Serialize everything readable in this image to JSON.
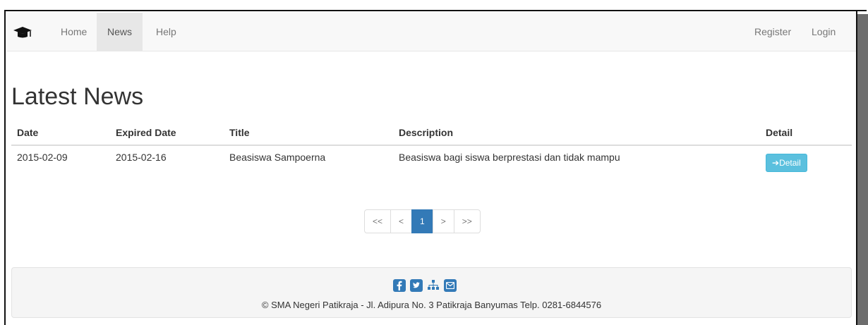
{
  "nav": {
    "left": [
      "Home",
      "News",
      "Help"
    ],
    "right": [
      "Register",
      "Login"
    ],
    "active": "News"
  },
  "page": {
    "heading": "Latest News"
  },
  "table": {
    "headers": [
      "Date",
      "Expired Date",
      "Title",
      "Description",
      "Detail"
    ],
    "rows": [
      {
        "date": "2015-02-09",
        "expired": "2015-02-16",
        "title": "Beasiswa Sampoerna",
        "description": "Beasiswa bagi siswa berprestasi dan tidak mampu",
        "detail_label": "Detail"
      }
    ]
  },
  "pagination": {
    "first": "<<",
    "prev": "<",
    "current": "1",
    "next": ">",
    "last": ">>"
  },
  "footer": {
    "text": "© SMA Negeri Patikraja - Jl. Adipura No. 3 Patikraja Banyumas Telp. 0281-6844576",
    "icons": [
      "facebook-icon",
      "twitter-icon",
      "sitemap-icon",
      "mail-icon"
    ]
  },
  "colors": {
    "primary": "#337ab7",
    "info": "#5bc0de",
    "navbar": "#f8f8f8"
  }
}
